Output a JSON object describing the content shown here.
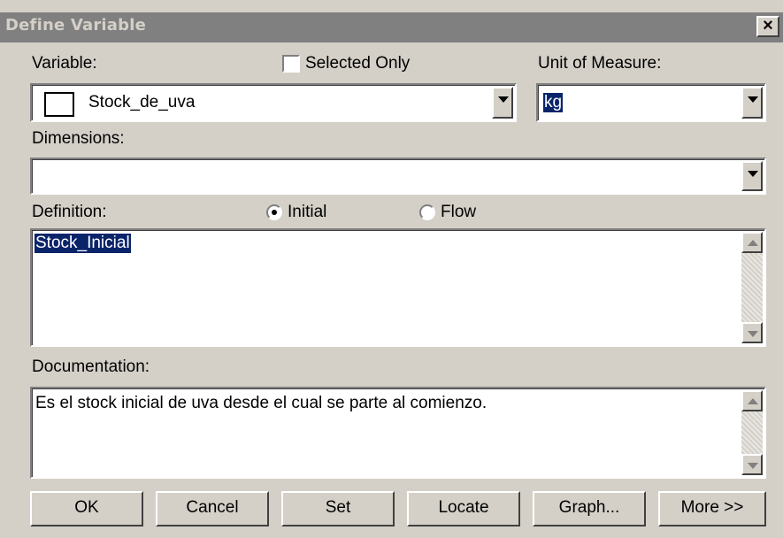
{
  "window": {
    "title": "Define Variable",
    "close_label": "×"
  },
  "variable": {
    "label": "Variable:",
    "value": "Stock_de_uva"
  },
  "selected_only": {
    "label": "Selected Only",
    "checked": false
  },
  "unit": {
    "label": "Unit of Measure:",
    "value": "kg"
  },
  "dimensions": {
    "label": "Dimensions:",
    "value": ""
  },
  "definition": {
    "label": "Definition:",
    "options": [
      {
        "label": "Initial",
        "selected": true
      },
      {
        "label": "Flow",
        "selected": false
      }
    ],
    "text": "Stock_Inicial"
  },
  "documentation": {
    "label": "Documentation:",
    "text": "Es el stock inicial de uva desde el cual se parte al comienzo."
  },
  "buttons": {
    "ok": "OK",
    "cancel": "Cancel",
    "set": "Set",
    "locate": "Locate",
    "graph": "Graph...",
    "more": "More >>"
  }
}
